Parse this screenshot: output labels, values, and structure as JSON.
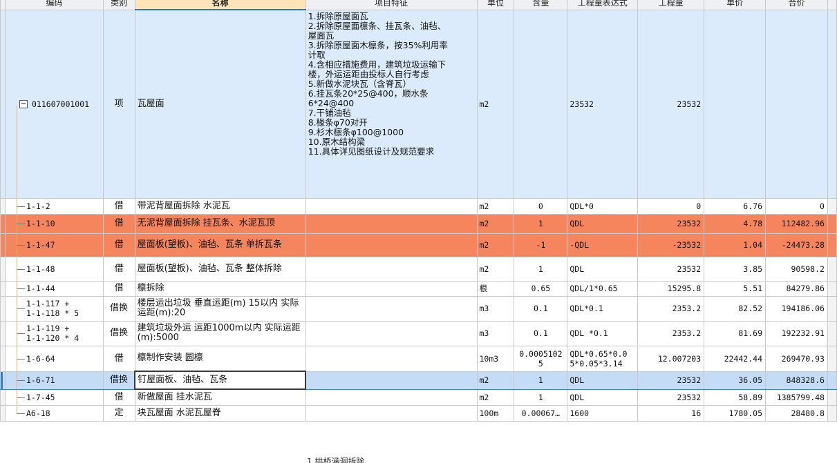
{
  "headers": {
    "code": "编码",
    "type": "类别",
    "name": "名称",
    "feature": "项目特征",
    "unit": "单位",
    "qty": "含量",
    "expr": "工程量表达式",
    "amount": "工程量",
    "price": "单价",
    "total": "合价"
  },
  "main_item": {
    "code": "011607001001",
    "type": "项",
    "name": "瓦屋面",
    "unit": "m2",
    "expr": "23532",
    "amount": "23532",
    "features": [
      "1.拆除原屋面瓦",
      "2.拆除原屋面檩条、挂瓦条、油毡、",
      "屋面瓦",
      "3.拆除原屋面木檩条，按35%利用率",
      "计取",
      "4.含相应措施费用，建筑垃圾运输下",
      "楼，外运运距由投标人自行考虑",
      "5.新做水泥块瓦（含脊瓦）",
      "6.挂瓦条20*25@400，顺水条",
      "6*24@400",
      "7.干铺油毡",
      "8.椽条φ70对开",
      "9.杉木檩条φ100@1000",
      "10.原木结构梁",
      "11.具体详见图纸设计及规范要求"
    ]
  },
  "rows": [
    {
      "code": [
        "1-1-2"
      ],
      "type": "借",
      "name": "带泥背屋面拆除 水泥瓦",
      "unit": "m2",
      "qty": "0",
      "expr": "QDL*0",
      "amount": "0",
      "price": "6.76",
      "total": "0",
      "style": ""
    },
    {
      "code": [
        "1-1-10"
      ],
      "type": "借",
      "name": "无泥背屋面拆除 挂瓦条、水泥瓦顶",
      "unit": "m2",
      "qty": "1",
      "expr": "QDL",
      "amount": "23532",
      "price": "4.78",
      "total": "112482.96",
      "style": "orange"
    },
    {
      "code": [
        "1-1-47"
      ],
      "type": "借",
      "name": "屋面板(望板)、油毡、瓦条 单拆瓦条",
      "unit": "m2",
      "qty": "-1",
      "expr": "-QDL",
      "amount": "-23532",
      "price": "1.04",
      "total": "-24473.28",
      "style": "orange"
    },
    {
      "code": [
        "1-1-48"
      ],
      "type": "借",
      "name": "屋面板(望板)、油毡、瓦条 整体拆除",
      "unit": "m2",
      "qty": "1",
      "expr": "QDL",
      "amount": "23532",
      "price": "3.85",
      "total": "90598.2",
      "style": ""
    },
    {
      "code": [
        "1-1-44"
      ],
      "type": "借",
      "name": "檩拆除",
      "unit": "根",
      "qty": "0.65",
      "expr": "QDL/1*0.65",
      "amount": "15295.8",
      "price": "5.51",
      "total": "84279.86",
      "style": ""
    },
    {
      "code": [
        "1-1-117 +",
        "1-1-118 * 5"
      ],
      "type": "借换",
      "name": "楼层运出垃圾 垂直运距(m) 15以内 实际运距(m):20",
      "unit": "m3",
      "qty": "0.1",
      "expr": "QDL*0.1",
      "amount": "2353.2",
      "price": "82.52",
      "total": "194186.06",
      "style": ""
    },
    {
      "code": [
        "1-1-119 +",
        "1-1-120 * 4"
      ],
      "type": "借换",
      "name": "建筑垃圾外运 运距1000m以内  实际运距(m):5000",
      "unit": "m3",
      "qty": "0.1",
      "expr": "QDL *0.1",
      "amount": "2353.2",
      "price": "81.69",
      "total": "192232.91",
      "style": ""
    },
    {
      "code": [
        "1-6-64"
      ],
      "type": "借",
      "name": "檩制作安装 圆檩",
      "unit": "10m3",
      "qty": "0.0005102 5",
      "expr": "QDL*0.65*0.0 5*0.05*3.14",
      "amount": "12.007203",
      "price": "22442.44",
      "total": "269470.93",
      "style": ""
    },
    {
      "code": [
        "1-6-71"
      ],
      "type": "借换",
      "name": "钉屋面板、油毡、瓦条",
      "unit": "m2",
      "qty": "1",
      "expr": "QDL",
      "amount": "23532",
      "price": "36.05",
      "total": "848328.6",
      "style": "selected"
    },
    {
      "code": [
        "1-7-45"
      ],
      "type": "借",
      "name": "新做屋面 挂水泥瓦",
      "unit": "m2",
      "qty": "1",
      "expr": "QDL",
      "amount": "23532",
      "price": "58.89",
      "total": "1385799.48",
      "style": ""
    },
    {
      "code": [
        "A6-18"
      ],
      "type": "定",
      "name": "块瓦屋面 水泥瓦屋脊",
      "unit": "100m",
      "qty": "0.00067…",
      "expr": "1600",
      "amount": "16",
      "price": "1780.05",
      "total": "28480.8",
      "style": ""
    }
  ],
  "next_item_feature_partial": "1.拱桥涵洞拆除"
}
